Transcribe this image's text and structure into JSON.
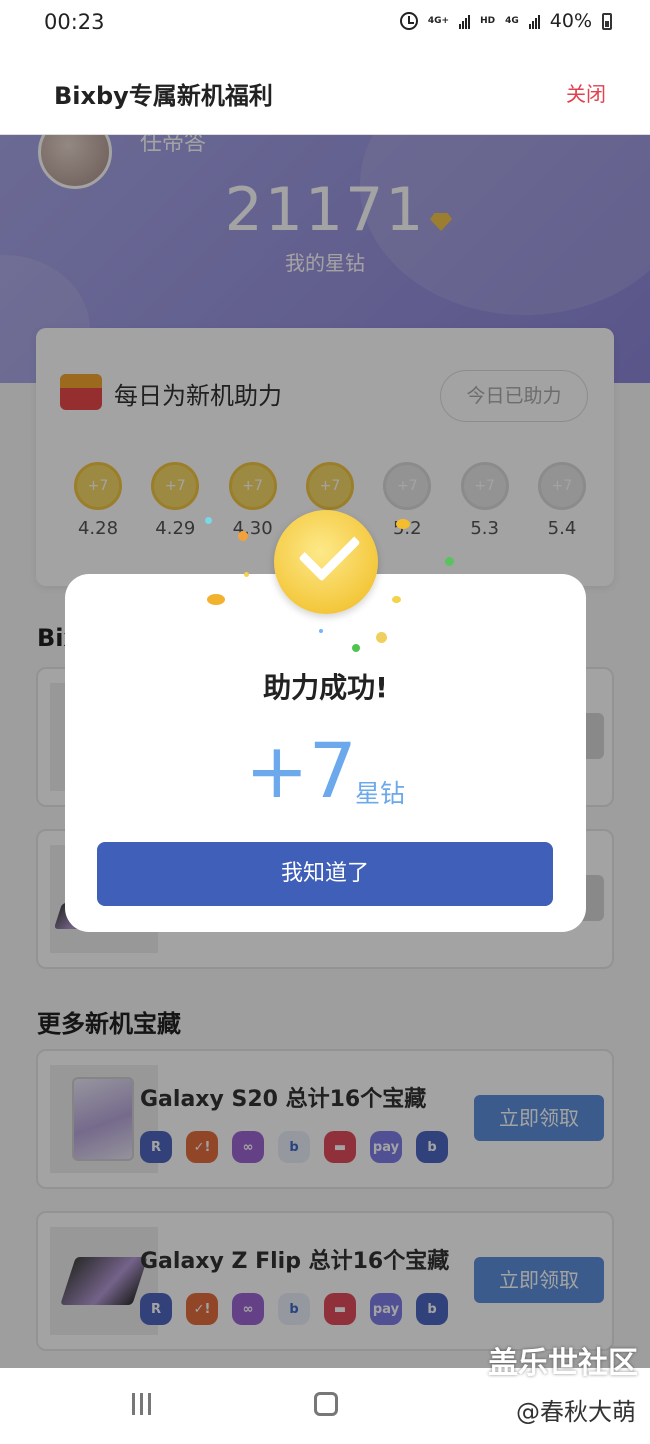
{
  "status_bar": {
    "time": "00:23",
    "network_1": "4G+",
    "network_2": "HD",
    "network_3": "4G",
    "battery": "40%"
  },
  "header": {
    "title": "Bixby专属新机福利",
    "close": "关闭"
  },
  "hero": {
    "username": "任帝答",
    "points": "21171",
    "points_label": "我的星钻"
  },
  "daily": {
    "title": "每日为新机助力",
    "button": "今日已助力",
    "days": [
      {
        "date": "4.28",
        "reward": "+7"
      },
      {
        "date": "4.29",
        "reward": "+7"
      },
      {
        "date": "4.30",
        "reward": "+7"
      },
      {
        "date": "",
        "reward": "+7"
      },
      {
        "date": "5.2",
        "reward": "+7"
      },
      {
        "date": "5.3",
        "reward": "+7"
      },
      {
        "date": "5.4",
        "reward": "+7"
      }
    ]
  },
  "section_bixby": {
    "title": "Bix"
  },
  "section_more": {
    "title": "更多新机宝藏",
    "items": [
      {
        "name": "Galaxy S20 总计16个宝藏",
        "claim": "立即领取"
      },
      {
        "name": "Galaxy Z Flip 总计16个宝藏",
        "claim": "立即领取"
      }
    ],
    "app_icon_labels": [
      "R",
      "✓!",
      "∞",
      "b",
      "▬",
      "pay",
      "b"
    ]
  },
  "modal": {
    "title": "助力成功!",
    "reward": "+7",
    "reward_unit": "星钻",
    "button": "我知道了"
  },
  "watermark": {
    "line1": "盖乐世社区",
    "line2": "@春秋大萌"
  },
  "colors": {
    "hero_start": "#a8a6e8",
    "hero_end": "#8d86d8",
    "accent_blue": "#3f5fb8",
    "reward_blue": "#6ca8ec",
    "close_red": "#e0424f",
    "coin_gold": "#f4c83d"
  }
}
